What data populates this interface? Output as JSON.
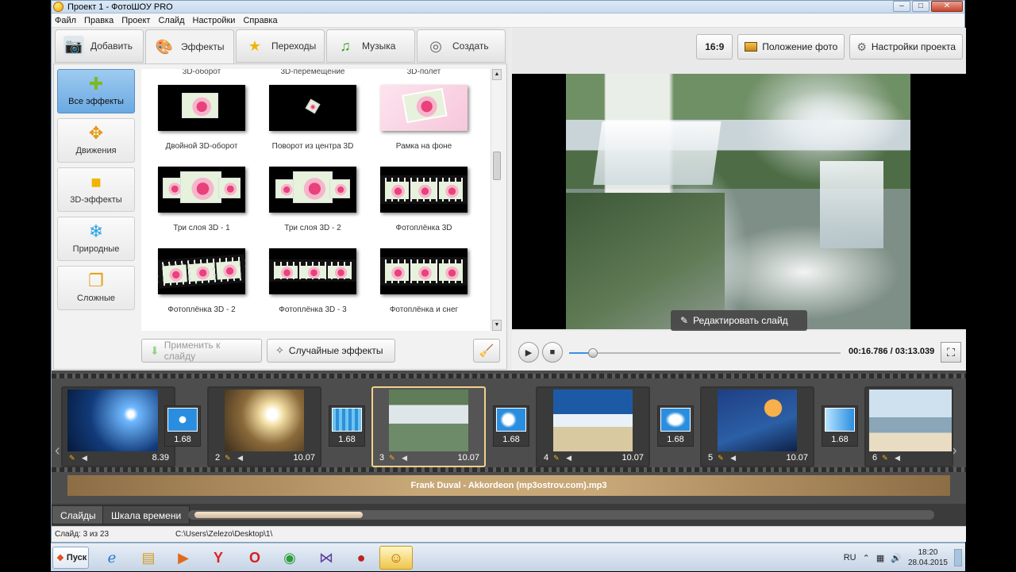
{
  "window": {
    "title": "Проект 1 - ФотоШОУ PRO"
  },
  "menu": [
    "Файл",
    "Правка",
    "Проект",
    "Слайд",
    "Настройки",
    "Справка"
  ],
  "tabs": [
    {
      "label": "Добавить",
      "icon": "camera-icon"
    },
    {
      "label": "Эффекты",
      "icon": "palette-icon"
    },
    {
      "label": "Переходы",
      "icon": "star-icon"
    },
    {
      "label": "Музыка",
      "icon": "music-note-icon"
    },
    {
      "label": "Создать",
      "icon": "film-reel-icon"
    }
  ],
  "categories": [
    "Все эффекты",
    "Движения",
    "3D-эффекты",
    "Природные",
    "Сложные"
  ],
  "grid_cutoff": [
    "3D-оборот",
    "3D-перемещение",
    "3D-полет"
  ],
  "effects": [
    "Двойной 3D-оборот",
    "Поворот из центра 3D",
    "Рамка на фоне",
    "Три слоя 3D - 1",
    "Три слоя 3D - 2",
    "Фотоплёнка 3D",
    "Фотоплёнка 3D - 2",
    "Фотоплёнка 3D - 3",
    "Фотоплёнка и снег"
  ],
  "actions": {
    "apply": "Применить к слайду",
    "random": "Случайные эффекты"
  },
  "preview_tools": {
    "ratio": "16:9",
    "photo_position": "Положение фото",
    "project_settings": "Настройки проекта"
  },
  "edit_slide": "Редактировать слайд",
  "player": {
    "time": "00:16.786 / 03:13.039",
    "progress": 0.087
  },
  "slides": [
    {
      "num": "",
      "dur": "8.39"
    },
    {
      "num": "2",
      "dur": "10.07"
    },
    {
      "num": "3",
      "dur": "10.07"
    },
    {
      "num": "4",
      "dur": "10.07"
    },
    {
      "num": "5",
      "dur": "10.07"
    },
    {
      "num": "6",
      "dur": ""
    }
  ],
  "transitions": [
    "1.68",
    "1.68",
    "1.68",
    "1.68",
    "1.68"
  ],
  "audio_track": "Frank Duval - Akkordeon (mp3ostrov.com).mp3",
  "bottom_tabs": [
    "Слайды",
    "Шкала времени"
  ],
  "status": {
    "slide_count": "Слайд: 3 из 23",
    "path": "C:\\Users\\Zelezo\\Desktop\\1\\"
  },
  "taskbar": {
    "start": "Пуск",
    "lang": "RU",
    "time": "18:20",
    "date": "28.04.2015"
  }
}
